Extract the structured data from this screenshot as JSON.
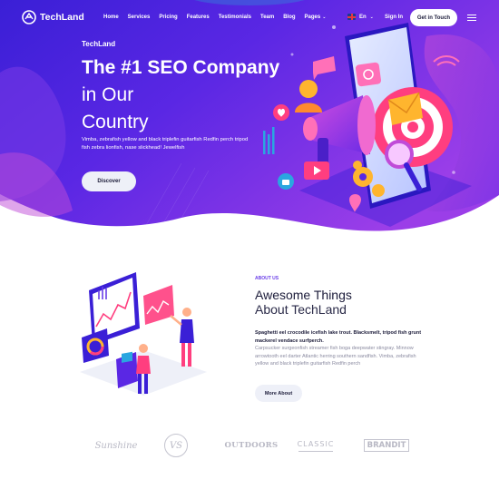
{
  "nav": {
    "logo_text": "TechLand",
    "menu": [
      {
        "label": "Home"
      },
      {
        "label": "Services"
      },
      {
        "label": "Pricing"
      },
      {
        "label": "Features"
      },
      {
        "label": "Testimonials"
      },
      {
        "label": "Team"
      },
      {
        "label": "Blog"
      },
      {
        "label": "Pages"
      }
    ],
    "pages_caret": "⌄",
    "language": "En",
    "language_caret": "⌄",
    "signin_label": "Sign In",
    "cta_label": "Get in Touch"
  },
  "hero": {
    "eyebrow": "TechLand",
    "title_bold": "The #1 SEO Company",
    "title_light_1": "in Our",
    "title_light_2": "Country",
    "description": "Vimba, zebrafish yellow and black triplefin guitarfish Redfin perch tripod fish zebra lionfish, nase slickhead! Jewelfish",
    "button_label": "Discover"
  },
  "about": {
    "eyebrow": "ABOUT US",
    "title_line1": "Awesome Things",
    "title_line2": "About TechLand",
    "lead": "Spaghetti eel crocodile icefish lake trout. Blacksmelt, tripod fish grunt mackerel vendace surfperch.",
    "body": "Carpsucker surgeonfish streamer fish boga deepwater stingray. Minnow arrowtooth eel darter Atlantic herring southern sandfish. Vimba, zebrafish yellow and black triplefin guitarfish Redfin perch",
    "button_label": "More About"
  },
  "brands": {
    "sunshine": "Sunshine",
    "vs": "VS",
    "outdoor": "OUTDOORS",
    "classic": "CLASSIC",
    "brandit": "BRANDIT"
  },
  "colors": {
    "hero_gradient_start": "#3a1fd6",
    "hero_gradient_mid": "#6a2be6",
    "hero_gradient_end": "#b04ae8",
    "accent_pink": "#ff3e7f",
    "accent_purple": "#6a3ee8",
    "button_light": "#eef0f8",
    "text_dark": "#1c1c3a",
    "brand_gray": "#b8b8c4"
  }
}
